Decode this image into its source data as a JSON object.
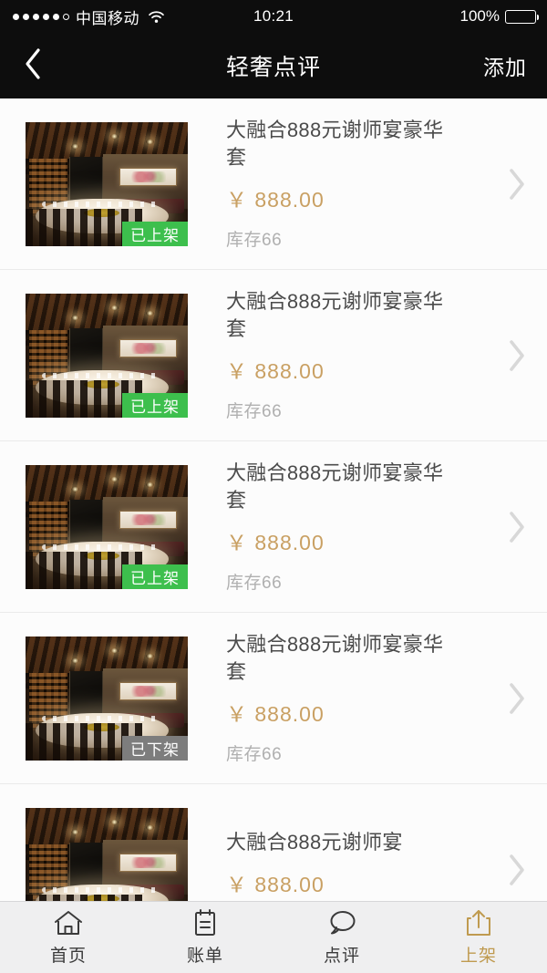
{
  "status_bar": {
    "signal_dots_filled": 5,
    "signal_dots_total": 6,
    "carrier": "中国移动",
    "wifi_icon": "wifi-icon",
    "time": "10:21",
    "battery_percent": "100%",
    "battery_icon": "battery-full-icon"
  },
  "nav_bar": {
    "back_icon": "chevron-left-icon",
    "title": "轻奢点评",
    "action_label": "添加"
  },
  "colors": {
    "nav_background": "#0d0d0d",
    "price_gold": "#c9a063",
    "badge_on_shelf": "#3dbf4d",
    "badge_off_shelf": "#7d7d7d",
    "tab_active": "#bf9a4f",
    "page_background": "#fcfcfc",
    "separator": "#eaeaea"
  },
  "list": {
    "items": [
      {
        "title": "大融合888元谢师宴豪华套",
        "price": "￥ 888.00",
        "stock": "库存66",
        "badge": "已上架",
        "badge_state": "on",
        "image_alt": "banquet-room-photo",
        "chevron_icon": "chevron-right-icon"
      },
      {
        "title": "大融合888元谢师宴豪华套",
        "price": "￥ 888.00",
        "stock": "库存66",
        "badge": "已上架",
        "badge_state": "on",
        "image_alt": "banquet-room-photo",
        "chevron_icon": "chevron-right-icon"
      },
      {
        "title": "大融合888元谢师宴豪华套",
        "price": "￥ 888.00",
        "stock": "库存66",
        "badge": "已上架",
        "badge_state": "on",
        "image_alt": "banquet-room-photo",
        "chevron_icon": "chevron-right-icon"
      },
      {
        "title": "大融合888元谢师宴豪华套",
        "price": "￥ 888.00",
        "stock": "库存66",
        "badge": "已下架",
        "badge_state": "off",
        "image_alt": "banquet-room-photo",
        "chevron_icon": "chevron-right-icon"
      },
      {
        "title": "大融合888元谢师宴",
        "price": "￥ 888.00",
        "stock": "",
        "badge": "",
        "badge_state": "none",
        "image_alt": "banquet-room-photo",
        "chevron_icon": "chevron-right-icon"
      }
    ]
  },
  "tab_bar": {
    "tabs": [
      {
        "label": "首页",
        "icon": "home-icon",
        "active": false
      },
      {
        "label": "账单",
        "icon": "clipboard-icon",
        "active": false
      },
      {
        "label": "点评",
        "icon": "comment-icon",
        "active": false
      },
      {
        "label": "上架",
        "icon": "upload-icon",
        "active": true
      }
    ]
  }
}
